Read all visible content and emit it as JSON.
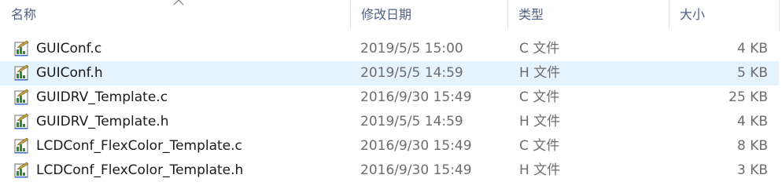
{
  "columns": {
    "name": "名称",
    "date": "修改日期",
    "type": "类型",
    "size": "大小"
  },
  "files": [
    {
      "name": "GUIConf.c",
      "modified": "2019/5/5 15:00",
      "type": "C 文件",
      "size": "4 KB",
      "icon": "c-source-file-icon"
    },
    {
      "name": "GUIConf.h",
      "modified": "2019/5/5 14:59",
      "type": "H 文件",
      "size": "5 KB",
      "icon": "header-file-icon"
    },
    {
      "name": "GUIDRV_Template.c",
      "modified": "2016/9/30 15:49",
      "type": "C 文件",
      "size": "25 KB",
      "icon": "c-source-file-icon"
    },
    {
      "name": "GUIDRV_Template.h",
      "modified": "2019/5/5 14:59",
      "type": "H 文件",
      "size": "4 KB",
      "icon": "header-file-icon"
    },
    {
      "name": "LCDConf_FlexColor_Template.c",
      "modified": "2016/9/30 15:49",
      "type": "C 文件",
      "size": "8 KB",
      "icon": "c-source-file-icon"
    },
    {
      "name": "LCDConf_FlexColor_Template.h",
      "modified": "2016/9/30 15:49",
      "type": "H 文件",
      "size": "3 KB",
      "icon": "header-file-icon"
    }
  ],
  "colors": {
    "header_text": "#4d6082",
    "hover_row": "#e5f3ff",
    "secondary_text": "#6d6d6d"
  }
}
